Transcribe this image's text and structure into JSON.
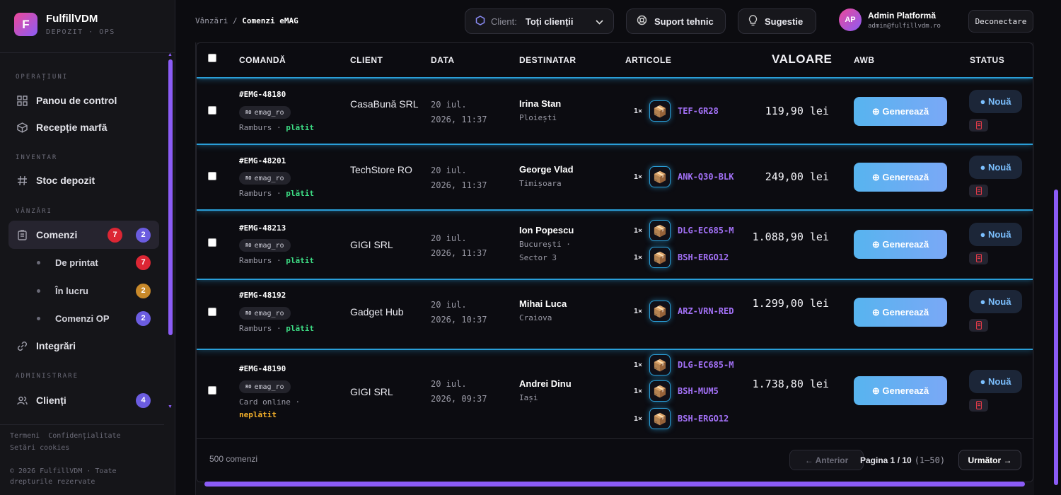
{
  "brand": {
    "name": "FulfillVDM",
    "subtitle": "DEPOZIT · OPS",
    "logo_letter": "F"
  },
  "sidebar": {
    "sections": [
      "OPERAȚIUNI",
      "INVENTAR",
      "VÂNZĂRI",
      "ADMINISTRARE"
    ],
    "items": [
      {
        "label": "Panou de control",
        "icon": "grid-icon"
      },
      {
        "label": "Recepție marfă",
        "icon": "box-icon"
      },
      {
        "label": "Stoc depozit",
        "icon": "hash-icon"
      },
      {
        "label": "Comenzi",
        "icon": "clipboard-icon",
        "badge_red": "7",
        "badge_purple": "2"
      },
      {
        "label": "Integrări",
        "icon": "link-icon"
      },
      {
        "label": "Clienți",
        "icon": "users-icon",
        "badge": "4"
      }
    ],
    "subitems": [
      {
        "label": "De printat",
        "badge": "7"
      },
      {
        "label": "În lucru",
        "badge": "2"
      },
      {
        "label": "Comenzi OP",
        "badge": "2"
      }
    ],
    "footer": {
      "terms": "Termeni",
      "privacy": "Confidențialitate",
      "cookies": "Setări cookies",
      "copyright": "© 2026 FulfillVDM · Toate drepturile rezervate"
    }
  },
  "header": {
    "breadcrumb_parent": "Vânzări",
    "breadcrumb_sep": "/",
    "breadcrumb_current": "Comenzi eMAG",
    "client_label": "Client:",
    "client_value": "Toți clienții",
    "support": "Suport tehnic",
    "suggest": "Sugestie",
    "user_initials": "AP",
    "user_name": "Admin Platformă",
    "user_email": "admin@fulfillvdm.ro",
    "logout": "Deconectare"
  },
  "table": {
    "columns": {
      "order": "COMANDĂ",
      "client": "CLIENT",
      "date": "DATA",
      "recipient": "DESTINATAR",
      "items": "ARTICOLE",
      "value": "VALOARE",
      "awb": "AWB",
      "status": "STATUS"
    },
    "rows": [
      {
        "id": "#EMG-48180",
        "source_flag": "RO",
        "source": "emag_ro",
        "pay_method": "Ramburs ·",
        "pay_status": "plătit",
        "paid": true,
        "client": "CasaBună SRL",
        "date": "20 iul.",
        "time": "2026, 11:37",
        "name": "Irina Stan",
        "city": "Ploiești",
        "items": [
          {
            "qty": "1×",
            "sku": "TEF-GR28"
          }
        ],
        "value": "119,90 lei",
        "awb": "⊕ Generează",
        "status": "● Nouă"
      },
      {
        "id": "#EMG-48201",
        "source_flag": "RO",
        "source": "emag_ro",
        "pay_method": "Ramburs ·",
        "pay_status": "plătit",
        "paid": true,
        "client": "TechStore RO",
        "date": "20 iul.",
        "time": "2026, 11:37",
        "name": "George Vlad",
        "city": "Timișoara",
        "items": [
          {
            "qty": "1×",
            "sku": "ANK-Q30-BLK"
          }
        ],
        "value": "249,00 lei",
        "awb": "⊕ Generează",
        "status": "● Nouă"
      },
      {
        "id": "#EMG-48213",
        "source_flag": "RO",
        "source": "emag_ro",
        "pay_method": "Ramburs ·",
        "pay_status": "plătit",
        "paid": true,
        "client": "GIGI SRL",
        "date": "20 iul.",
        "time": "2026, 11:37",
        "name": "Ion Popescu",
        "city": "București · Sector 3",
        "items": [
          {
            "qty": "1×",
            "sku": "DLG-EC685-M"
          },
          {
            "qty": "1×",
            "sku": "BSH-ERGO12"
          }
        ],
        "value": "1.088,90 lei",
        "awb": "⊕ Generează",
        "status": "● Nouă"
      },
      {
        "id": "#EMG-48192",
        "source_flag": "RO",
        "source": "emag_ro",
        "pay_method": "Ramburs ·",
        "pay_status": "plătit",
        "paid": true,
        "client": "Gadget Hub",
        "date": "20 iul.",
        "time": "2026, 10:37",
        "name": "Mihai Luca",
        "city": "Craiova",
        "items": [
          {
            "qty": "1×",
            "sku": "ARZ-VRN-RED"
          }
        ],
        "value": "1.299,00 lei",
        "awb": "⊕ Generează",
        "status": "● Nouă"
      },
      {
        "id": "#EMG-48190",
        "source_flag": "RO",
        "source": "emag_ro",
        "pay_method": "Card online ·",
        "pay_status": "neplătit",
        "paid": false,
        "client": "GIGI SRL",
        "date": "20 iul.",
        "time": "2026, 09:37",
        "name": "Andrei Dinu",
        "city": "Iași",
        "items": [
          {
            "qty": "1×",
            "sku": "DLG-EC685-M"
          },
          {
            "qty": "1×",
            "sku": "BSH-MUM5"
          },
          {
            "qty": "1×",
            "sku": "BSH-ERGO12"
          }
        ],
        "value": "1.738,80 lei",
        "awb": "⊕ Generează",
        "status": "● Nouă"
      }
    ],
    "footer": {
      "count": "500 comenzi",
      "prev": "← Anterior",
      "page": "Pagina 1 / 10",
      "range": "(1–50)",
      "next": "Următor →"
    }
  },
  "colors": {
    "accent": "#8b5cf6",
    "glow": "#2a9fd8",
    "paid": "#3ddc84",
    "unpaid": "#f5b12a",
    "sku": "#a371f7"
  }
}
